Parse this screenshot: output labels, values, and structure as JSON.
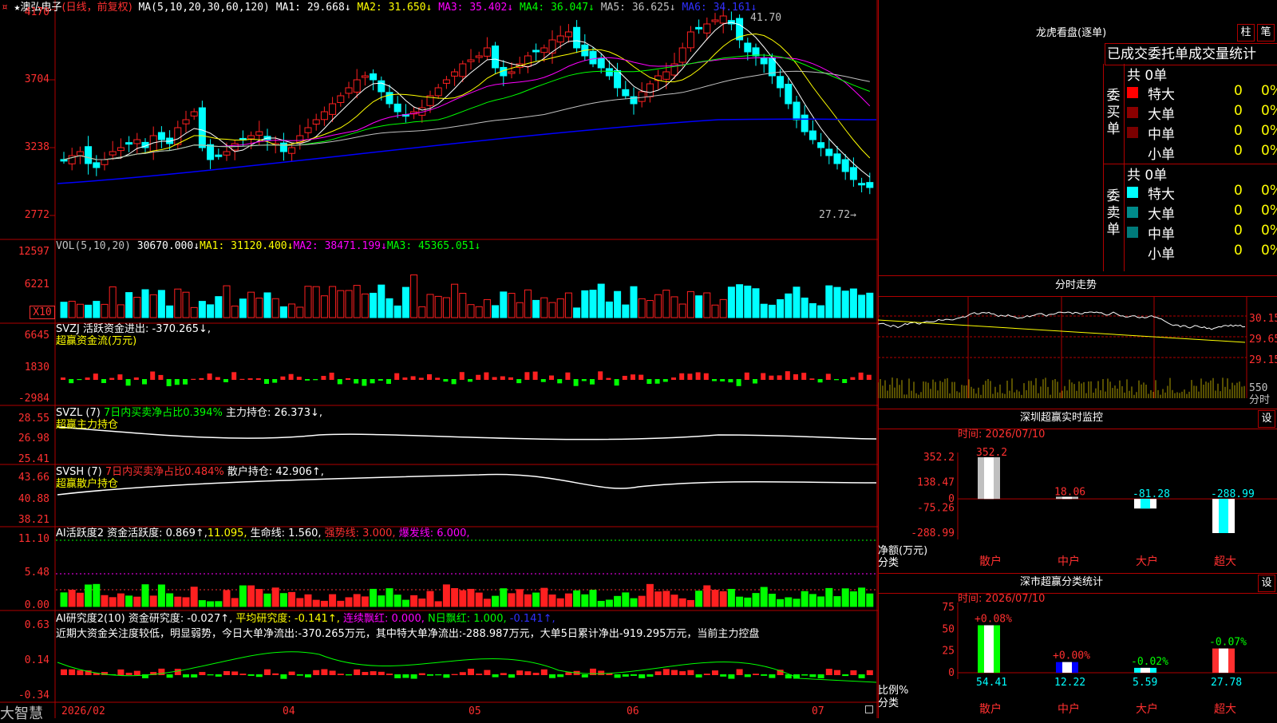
{
  "stock": {
    "star": "★",
    "name": "澳弘电子",
    "period": "(日线，前复权)"
  },
  "ma_header": {
    "label": "MA(5,10,20,30,60,120)",
    "ma1": "MA1: 29.668↓",
    "ma2": "MA2: 31.650↓",
    "ma3": "MA3: 35.402↓",
    "ma4": "MA4: 36.047↓",
    "ma5": "MA5: 36.625↓",
    "ma6": "MA6: 34.161↓"
  },
  "price_axis": [
    "4170",
    "3704",
    "3238",
    "2772"
  ],
  "annotations": {
    "high": "41.70",
    "low": "27.72→"
  },
  "vol_header": {
    "label": "VOL(5,10,20)",
    "vol": "30670.000↓",
    "ma1": "MA1: 31120.400↓",
    "ma2": "MA2: 38471.199↓",
    "ma3": "MA3: 45365.051↓"
  },
  "vol_axis": [
    "12597",
    "6221",
    "X10"
  ],
  "svzj": {
    "line1": "SVZJ  活跃资金进出: -370.265↓,",
    "line2": "超赢资金流(万元)",
    "axis": [
      "6645",
      "1830",
      "-2984"
    ]
  },
  "svzl": {
    "name": "SVZL (7)",
    "pct": "7日内买卖净占比0.394%",
    "hold": "主力持仓: 26.373↓,",
    "line2": "超赢主力持仓",
    "axis": [
      "28.55",
      "26.98",
      "25.41"
    ]
  },
  "svsh": {
    "name": "SVSH (7)",
    "pct": "7日内买卖净占比0.484%",
    "hold": "散户持仓: 42.906↑,",
    "line2": "超赢散户持仓",
    "axis": [
      "43.66",
      "40.88",
      "38.21"
    ]
  },
  "ai2": {
    "name": "AI活跃度2 资金活跃度: 0.869↑,",
    "v2": "11.095,",
    "life": "生命线: 1.560,",
    "strong": "强势线: 3.000,",
    "burst": "爆发线: 6.000,",
    "axis": [
      "11.10",
      "5.48",
      "0.00"
    ]
  },
  "ai_res": {
    "name": "AI研究度2(10) 资金研究度: -0.027↑,",
    "avg": "平均研究度: -0.141↑,",
    "red": "连续飘红: 0.000,",
    "nred": "N日飘红: 1.000,",
    "last": "-0.141↑,",
    "note": "近期大资金关注度较低，明显弱势，今日大单净流出:-370.265万元，其中特大单净流出:-288.987万元，大单5日累计净出-919.295万元，当前主力控盘",
    "axis": [
      "0.63",
      "0.14",
      "-0.34"
    ]
  },
  "bottom_axis": {
    "logo": "大智慧",
    "labels": [
      "2026/02",
      "04",
      "05",
      "06",
      "07"
    ]
  },
  "right": {
    "lhk": {
      "title": "龙虎看盘(逐单)",
      "btn1": "柱",
      "btn2": "笔",
      "subtitle": "已成交委托单成交量统计",
      "buy_label": "委买单",
      "sell_label": "委卖单",
      "buy_total": "共 0单",
      "sell_total": "共 0单",
      "rows": [
        {
          "name": "特大",
          "v": "0",
          "p": "0%"
        },
        {
          "name": "大单",
          "v": "0",
          "p": "0%"
        },
        {
          "name": "中单",
          "v": "0",
          "p": "0%"
        },
        {
          "name": "小单",
          "v": "0",
          "p": "0%"
        }
      ]
    },
    "fenshi": {
      "title": "分时走势",
      "axis": [
        "30.15",
        "29.65",
        "29.15"
      ],
      "vol": "550",
      "vol_label": "分时"
    },
    "monitor": {
      "title": "深圳超赢实时监控",
      "btn": "设",
      "date": "时间: 2026/07/10",
      "axis": [
        "352.2",
        "138.47",
        "0",
        "-75.26",
        "-288.99"
      ],
      "ylabel": "净额(万元)",
      "xlabel": "分类",
      "categories": [
        "散户",
        "中户",
        "大户",
        "超大"
      ],
      "values": [
        "352.2",
        "18.06",
        "-81.28",
        "-288.99"
      ]
    },
    "stats": {
      "title": "深市超赢分类统计",
      "btn": "设",
      "date": "时间: 2026/07/10",
      "axis": [
        "75",
        "50",
        "25",
        "0"
      ],
      "ylabel": "比例%",
      "xlabel": "分类",
      "categories": [
        "散户",
        "中户",
        "大户",
        "超大"
      ],
      "values": [
        "54.41",
        "12.22",
        "5.59",
        "27.78"
      ],
      "changes": [
        "+0.08%",
        "+0.00%",
        "-0.02%",
        "-0.07%"
      ]
    }
  },
  "chart_data": [
    {
      "type": "bar",
      "title": "深圳超赢实时监控",
      "ylabel": "净额(万元)",
      "categories": [
        "散户",
        "中户",
        "大户",
        "超大"
      ],
      "values": [
        352.2,
        18.06,
        -81.28,
        -288.99
      ],
      "ylim": [
        -288.99,
        352.2
      ]
    },
    {
      "type": "bar",
      "title": "深市超赢分类统计",
      "ylabel": "比例%",
      "categories": [
        "散户",
        "中户",
        "大户",
        "超大"
      ],
      "values": [
        54.41,
        12.22,
        5.59,
        27.78
      ],
      "ylim": [
        0,
        75
      ]
    }
  ],
  "colors": {
    "up": "#ff2020",
    "down": "#00ffff",
    "frame": "#b00000",
    "ma1": "#ffffff",
    "ma2": "#ffff00",
    "ma3": "#ff00ff",
    "ma4": "#00ff00",
    "ma5": "#c0c0c0",
    "ma6": "#0000ff"
  }
}
